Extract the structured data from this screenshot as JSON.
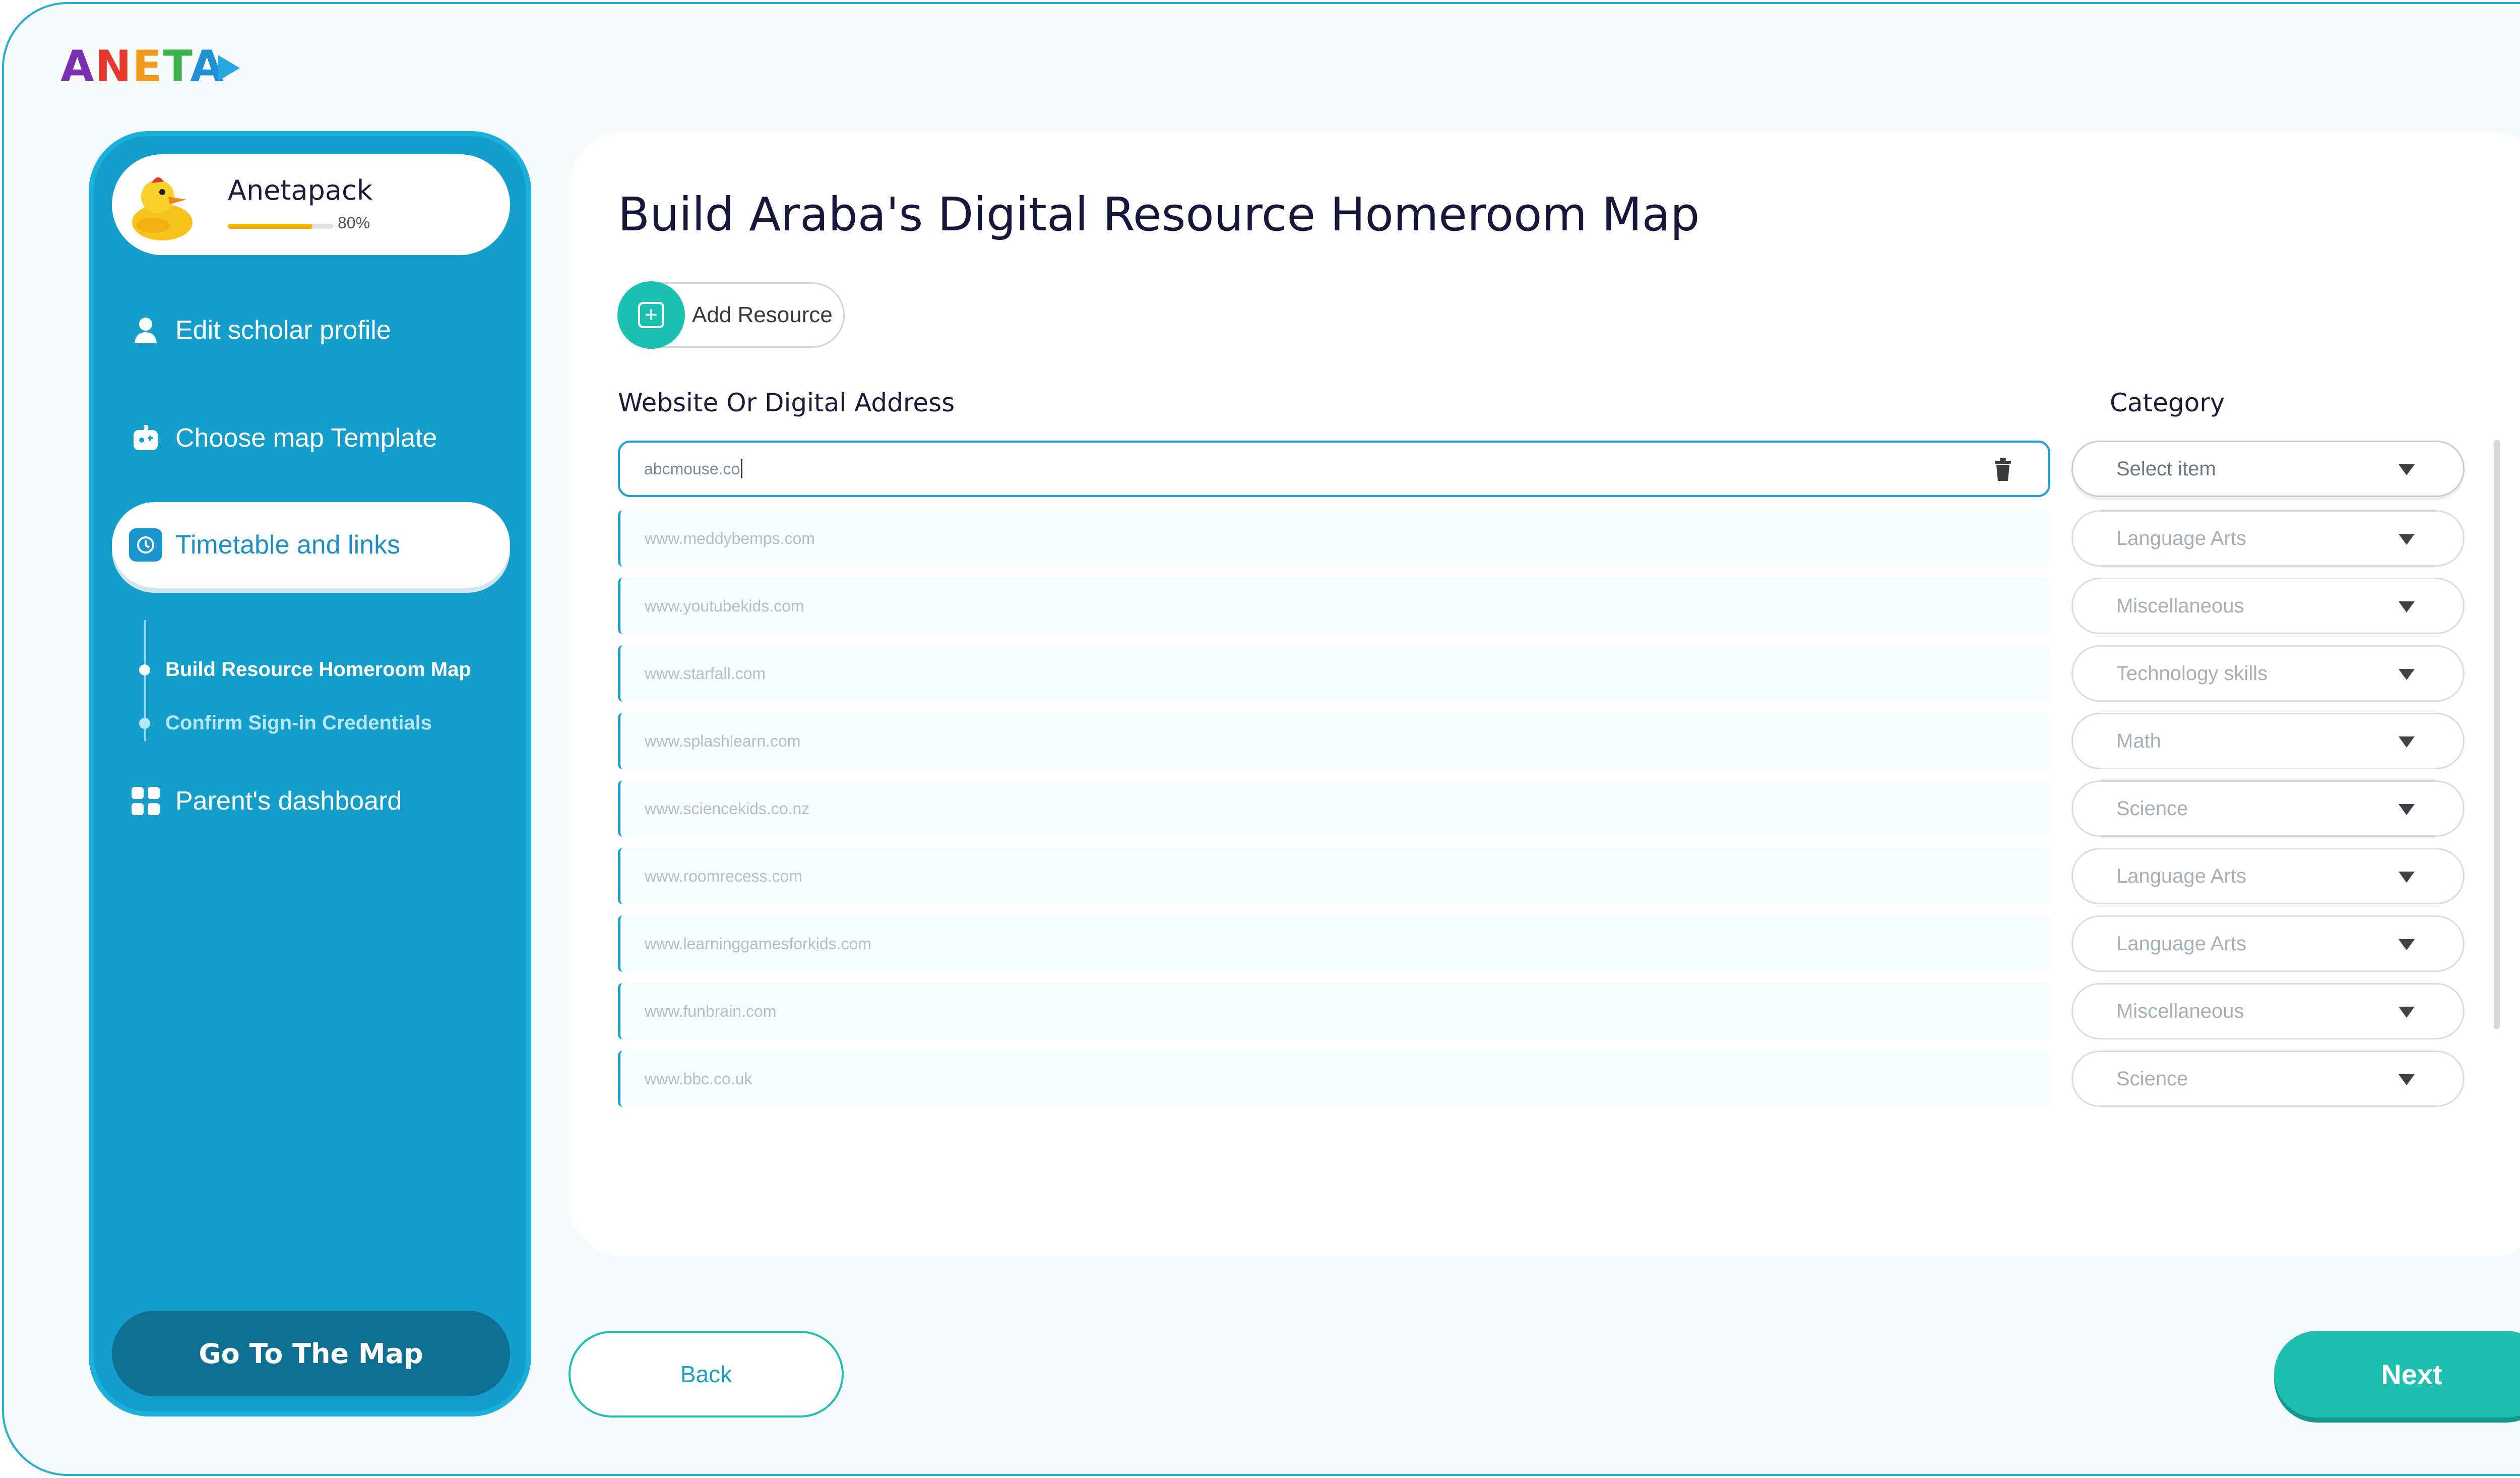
{
  "app": {
    "logo_text": "ANETA"
  },
  "profile": {
    "name": "Anetapack",
    "progress_label": "80%",
    "progress": 0.8
  },
  "sidebar": {
    "items": [
      {
        "label": "Edit scholar profile",
        "icon": "user-icon"
      },
      {
        "label": "Choose map Template",
        "icon": "map-template-icon"
      },
      {
        "label": "Timetable and links",
        "icon": "clock-icon",
        "active": true
      },
      {
        "label": "Parent's dashboard",
        "icon": "grid-icon"
      }
    ],
    "subitems": [
      {
        "label": "Build Resource Homeroom Map",
        "active": true
      },
      {
        "label": "Confirm Sign-in Credentials",
        "active": false
      }
    ],
    "go_to_map_label": "Go To The Map"
  },
  "main": {
    "title": "Build Araba's Digital Resource Homeroom Map",
    "add_resource_label": "Add Resource",
    "col_address": "Website Or Digital Address",
    "col_category": "Category",
    "rows": [
      {
        "address": "abcmouse.co",
        "category": "Select item"
      },
      {
        "address": "www.meddybemps.com",
        "category": "Language Arts"
      },
      {
        "address": "www.youtubekids.com",
        "category": "Miscellaneous"
      },
      {
        "address": "www.starfall.com",
        "category": "Technology skills"
      },
      {
        "address": "www.splashlearn.com",
        "category": "Math"
      },
      {
        "address": "www.sciencekids.co.nz",
        "category": "Science"
      },
      {
        "address": "www.roomrecess.com",
        "category": "Language Arts"
      },
      {
        "address": "www.learninggamesforkids.com",
        "category": "Language Arts"
      },
      {
        "address": "www.funbrain.com",
        "category": "Miscellaneous"
      },
      {
        "address": "www.bbc.co.uk",
        "category": "Science"
      }
    ]
  },
  "footer": {
    "back_label": "Back",
    "next_label": "Next"
  },
  "colors": {
    "sidebar": "#139ecb",
    "accent_teal": "#1fbfb0",
    "dark_button": "#0f6f93"
  }
}
